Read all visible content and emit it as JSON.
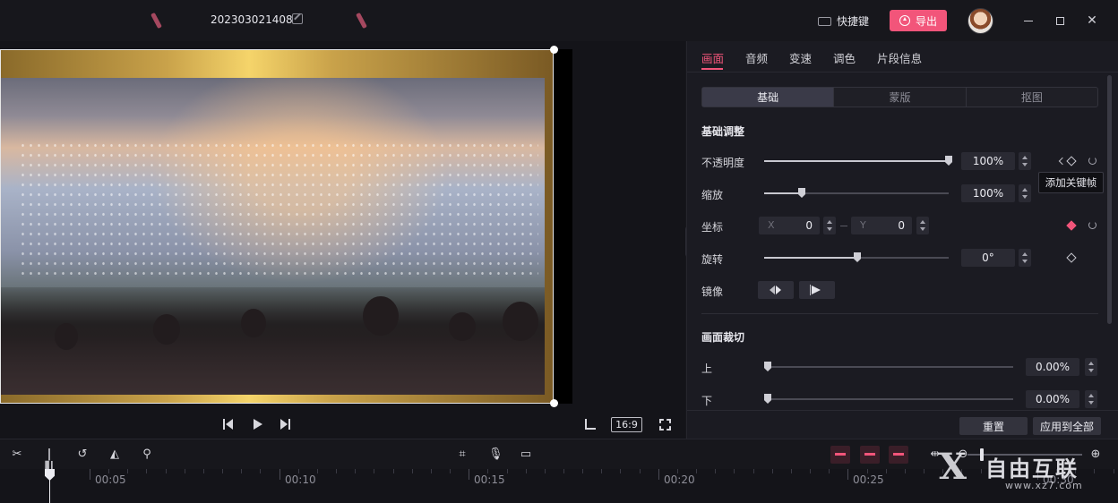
{
  "titlebar": {
    "project_title": "202303021408",
    "shortcut_label": "快捷键",
    "export_label": "导出"
  },
  "preview": {
    "aspect_ratio": "16:9"
  },
  "panel": {
    "tabs": [
      "画面",
      "音频",
      "变速",
      "调色",
      "片段信息"
    ],
    "active_tab": "画面",
    "subtabs": [
      "基础",
      "蒙版",
      "抠图"
    ],
    "active_subtab": "基础",
    "basic_section_title": "基础调整",
    "opacity": {
      "label": "不透明度",
      "value": "100%",
      "level": 1.0
    },
    "scale": {
      "label": "缩放",
      "value": "100%",
      "level": 0.2
    },
    "position": {
      "label": "坐标",
      "x_prefix": "X",
      "x_value": "0",
      "y_prefix": "Y",
      "y_value": "0"
    },
    "rotation": {
      "label": "旋转",
      "value": "0°",
      "level": 0.5
    },
    "mirror": {
      "label": "镜像"
    },
    "tooltip": "添加关键帧",
    "crop_section_title": "画面裁切",
    "crop_top": {
      "label": "上",
      "value": "0.00%",
      "level": 0
    },
    "crop_bottom": {
      "label": "下",
      "value": "0.00%",
      "level": 0
    },
    "reset_label": "重置",
    "apply_all_label": "应用到全部"
  },
  "timeline": {
    "ruler_labels": [
      "00:05",
      "00:10",
      "00:15",
      "00:20",
      "00:25",
      "00:30"
    ]
  },
  "watermark": {
    "brand": "自由互联",
    "url": "www.xz7.com"
  },
  "colors": {
    "accent": "#f2557a",
    "background": "#17171c",
    "panel": "#1b1b22"
  }
}
